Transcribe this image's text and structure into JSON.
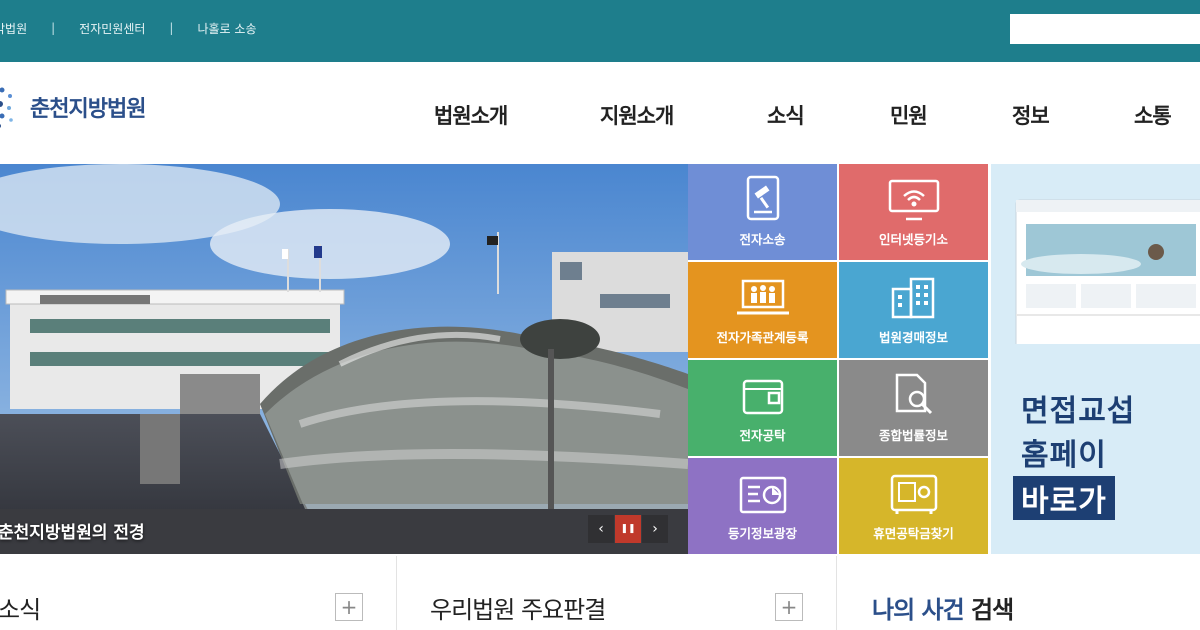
{
  "topbar": {
    "links": [
      "각법원",
      "전자민원센터",
      "나홀로 소송"
    ],
    "separator": "|",
    "search": {
      "placeholder": "",
      "value": ""
    }
  },
  "logo": {
    "title": "춘천지방법원"
  },
  "nav": [
    "법원소개",
    "지원소개",
    "소식",
    "민원",
    "정보",
    "소통"
  ],
  "hero": {
    "caption": "춘천지방법원의 전경",
    "controls": {
      "prev": "‹",
      "pause": "❚❚",
      "next": "›"
    }
  },
  "quick_tiles": [
    {
      "label": "전자소송",
      "icon": "tablet-gavel-icon",
      "color": "#6f8ed6"
    },
    {
      "label": "인터넷등기소",
      "icon": "monitor-wifi-icon",
      "color": "#e06b6b"
    },
    {
      "label": "전자가족관계등록",
      "icon": "family-laptop-icon",
      "color": "#e4941f"
    },
    {
      "label": "법원경매정보",
      "icon": "buildings-icon",
      "color": "#4aa6d1"
    },
    {
      "label": "전자공탁",
      "icon": "wallet-icon",
      "color": "#48b06c"
    },
    {
      "label": "종합법률정보",
      "icon": "document-search-icon",
      "color": "#8a8a8a"
    },
    {
      "label": "등기정보광장",
      "icon": "chart-screen-icon",
      "color": "#8e72c4"
    },
    {
      "label": "휴면공탁금찾기",
      "icon": "safe-icon",
      "color": "#d6b62a"
    }
  ],
  "banner": {
    "lines": [
      "면접교섭",
      "홈페이",
      "바로가"
    ]
  },
  "sections": [
    {
      "title": "소식",
      "plus": "+"
    },
    {
      "title": "우리법원 주요판결",
      "plus": "+"
    },
    {
      "title_accent": "나의 사건",
      "title_rest": " 검색"
    }
  ],
  "colors": {
    "topbar": "#1e7e8c",
    "logo_text": "#2b4f8a",
    "banner_text": "#1d3f73"
  }
}
